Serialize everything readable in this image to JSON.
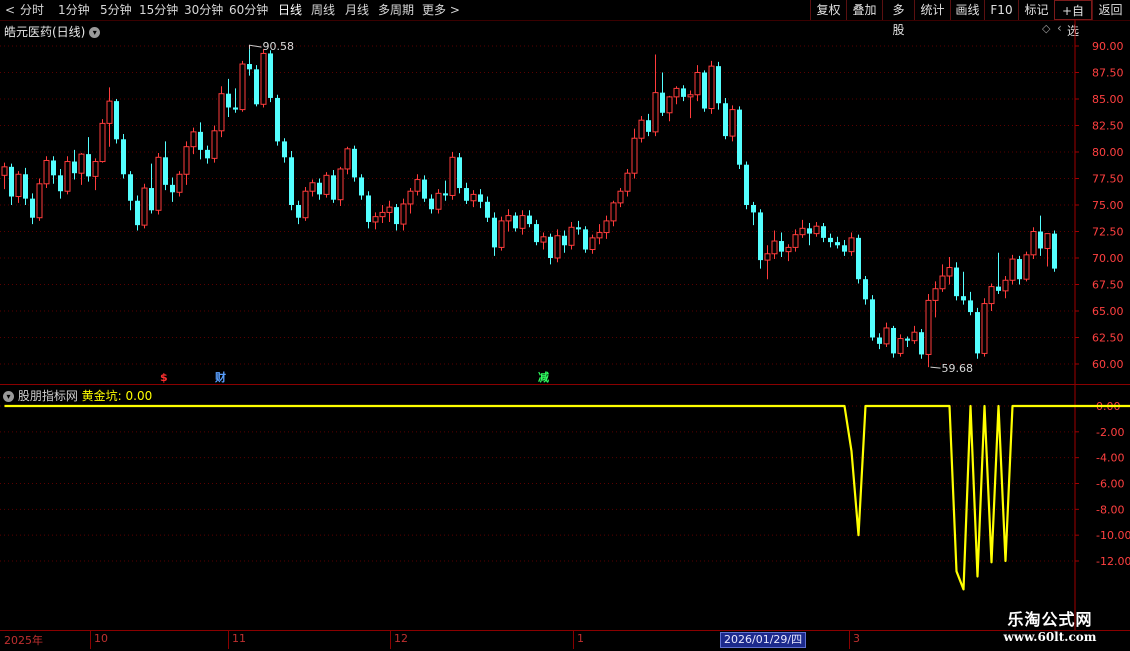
{
  "toolbar": {
    "periods": [
      "分时",
      "1分钟",
      "5分钟",
      "15分钟",
      "30分钟",
      "60分钟",
      "日线",
      "周线",
      "月线",
      "多周期",
      "更多"
    ],
    "active_period": "日线",
    "right_buttons": [
      "复权",
      "叠加",
      "多股",
      "统计",
      "画线",
      "F10",
      "标记",
      "+自选",
      "返回"
    ]
  },
  "colors": {
    "up": "#ff3c3c",
    "down": "#54ffff",
    "grid": "#5a0000",
    "axis_text": "#ff4040",
    "indicator": "#ffff00"
  },
  "main_chart": {
    "title": "皓元医药(日线)",
    "y_ticks": [
      "90.00",
      "87.50",
      "85.00",
      "82.50",
      "80.00",
      "77.50",
      "75.00",
      "72.50",
      "70.00",
      "67.50",
      "65.00",
      "62.50",
      "60.00"
    ],
    "high_label": "90.58",
    "low_label": "59.68",
    "event_markers": [
      {
        "text": "$",
        "color": "#ff3030"
      },
      {
        "text": "财",
        "color": "#5aa0ff"
      },
      {
        "text": "减",
        "color": "#30ff60"
      }
    ]
  },
  "indicator": {
    "name": "股朋指标网",
    "series_label": "黄金坑:",
    "series_value": "0.00",
    "y_ticks": [
      "0.00",
      "-2.00",
      "-4.00",
      "-6.00",
      "-8.00",
      "-10.00",
      "-12.00"
    ]
  },
  "time_axis": {
    "labels": [
      "2025年",
      "10",
      "11",
      "12",
      "1",
      "3"
    ],
    "cursor_date": "2026/01/29/四"
  },
  "watermark": {
    "line1": "乐淘公式网",
    "line2": "www.60lt.com"
  },
  "chart_data": [
    {
      "type": "candlestick",
      "title": "皓元医药(日线)",
      "ylim": [
        59,
        91
      ],
      "candles": [
        [
          77.8,
          79.0,
          76.5,
          78.6
        ],
        [
          78.6,
          78.9,
          75.0,
          75.8
        ],
        [
          75.8,
          78.2,
          75.2,
          77.9
        ],
        [
          77.9,
          78.5,
          75.0,
          75.6
        ],
        [
          75.6,
          76.1,
          73.2,
          73.8
        ],
        [
          73.8,
          77.5,
          73.5,
          77.0
        ],
        [
          77.0,
          79.6,
          76.6,
          79.2
        ],
        [
          79.2,
          79.6,
          77.0,
          77.8
        ],
        [
          77.8,
          78.4,
          75.6,
          76.3
        ],
        [
          76.3,
          79.6,
          76.0,
          79.1
        ],
        [
          79.1,
          80.2,
          77.4,
          78.0
        ],
        [
          78.0,
          79.9,
          76.9,
          79.8
        ],
        [
          79.8,
          81.4,
          77.2,
          77.7
        ],
        [
          77.7,
          79.4,
          76.4,
          79.1
        ],
        [
          79.1,
          83.1,
          79.0,
          82.7
        ],
        [
          82.7,
          86.1,
          80.5,
          84.8
        ],
        [
          84.8,
          85.0,
          80.8,
          81.2
        ],
        [
          81.2,
          81.7,
          77.5,
          77.9
        ],
        [
          77.9,
          78.2,
          74.5,
          75.4
        ],
        [
          75.4,
          75.9,
          72.6,
          73.1
        ],
        [
          73.1,
          77.0,
          72.8,
          76.6
        ],
        [
          76.6,
          78.9,
          74.2,
          74.5
        ],
        [
          74.5,
          79.9,
          74.1,
          79.5
        ],
        [
          79.5,
          81.0,
          76.4,
          76.9
        ],
        [
          76.9,
          77.6,
          75.3,
          76.2
        ],
        [
          76.2,
          78.2,
          75.8,
          77.9
        ],
        [
          77.9,
          81.0,
          76.9,
          80.5
        ],
        [
          80.5,
          82.3,
          79.8,
          81.9
        ],
        [
          81.9,
          82.8,
          79.3,
          80.2
        ],
        [
          80.2,
          80.6,
          78.9,
          79.4
        ],
        [
          79.4,
          82.5,
          79.0,
          82.0
        ],
        [
          82.0,
          86.2,
          81.4,
          85.5
        ],
        [
          85.5,
          86.9,
          83.3,
          84.2
        ],
        [
          84.2,
          86.0,
          83.7,
          84.0
        ],
        [
          84.0,
          88.6,
          83.8,
          88.3
        ],
        [
          88.3,
          89.7,
          87.2,
          87.8
        ],
        [
          87.8,
          88.2,
          84.3,
          84.5
        ],
        [
          84.5,
          89.7,
          84.2,
          89.3
        ],
        [
          89.3,
          89.6,
          84.7,
          85.1
        ],
        [
          85.1,
          85.4,
          80.6,
          81.0
        ],
        [
          81.0,
          81.3,
          79.0,
          79.5
        ],
        [
          79.5,
          80.1,
          74.5,
          75.0
        ],
        [
          75.0,
          75.4,
          73.2,
          73.8
        ],
        [
          73.8,
          76.7,
          73.5,
          76.3
        ],
        [
          76.3,
          77.4,
          75.8,
          77.1
        ],
        [
          77.1,
          77.5,
          75.5,
          76.0
        ],
        [
          76.0,
          78.1,
          75.7,
          77.8
        ],
        [
          77.8,
          78.3,
          75.2,
          75.5
        ],
        [
          75.5,
          78.6,
          74.9,
          78.4
        ],
        [
          78.4,
          80.5,
          77.9,
          80.3
        ],
        [
          80.3,
          80.6,
          77.2,
          77.6
        ],
        [
          77.6,
          77.9,
          75.5,
          75.9
        ],
        [
          75.9,
          76.3,
          72.8,
          73.4
        ],
        [
          73.4,
          74.3,
          72.7,
          73.9
        ],
        [
          73.9,
          75.0,
          73.3,
          74.3
        ],
        [
          74.3,
          75.4,
          73.4,
          74.8
        ],
        [
          74.8,
          75.1,
          72.6,
          73.2
        ],
        [
          73.2,
          75.6,
          72.6,
          75.1
        ],
        [
          75.1,
          76.6,
          74.2,
          76.3
        ],
        [
          76.3,
          77.9,
          75.9,
          77.4
        ],
        [
          77.4,
          77.8,
          75.3,
          75.6
        ],
        [
          75.6,
          76.0,
          74.2,
          74.6
        ],
        [
          74.6,
          76.5,
          74.2,
          76.1
        ],
        [
          76.1,
          77.3,
          75.4,
          75.9
        ],
        [
          75.9,
          80.0,
          75.5,
          79.5
        ],
        [
          79.5,
          79.9,
          76.1,
          76.6
        ],
        [
          76.6,
          77.1,
          75.1,
          75.4
        ],
        [
          75.4,
          76.4,
          74.8,
          76.0
        ],
        [
          76.0,
          76.5,
          74.7,
          75.3
        ],
        [
          75.3,
          75.8,
          73.4,
          73.8
        ],
        [
          73.8,
          74.3,
          70.2,
          71.0
        ],
        [
          71.0,
          73.9,
          70.7,
          73.5
        ],
        [
          73.5,
          74.6,
          72.5,
          74.0
        ],
        [
          74.0,
          74.3,
          72.5,
          72.8
        ],
        [
          72.8,
          74.5,
          72.2,
          74.0
        ],
        [
          74.0,
          74.5,
          72.9,
          73.2
        ],
        [
          73.2,
          73.6,
          71.2,
          71.5
        ],
        [
          71.5,
          72.4,
          70.8,
          72.0
        ],
        [
          72.0,
          72.3,
          69.4,
          70.0
        ],
        [
          70.0,
          72.7,
          69.6,
          72.1
        ],
        [
          72.1,
          72.6,
          70.5,
          71.2
        ],
        [
          71.2,
          73.4,
          70.8,
          72.9
        ],
        [
          72.9,
          73.5,
          72.2,
          72.7
        ],
        [
          72.7,
          73.0,
          70.5,
          70.8
        ],
        [
          70.8,
          72.2,
          70.4,
          71.9
        ],
        [
          71.9,
          73.2,
          71.3,
          72.4
        ],
        [
          72.4,
          74.0,
          71.8,
          73.5
        ],
        [
          73.5,
          75.4,
          73.0,
          75.2
        ],
        [
          75.2,
          76.6,
          74.8,
          76.3
        ],
        [
          76.3,
          78.4,
          75.8,
          78.0
        ],
        [
          78.0,
          82.2,
          77.5,
          81.3
        ],
        [
          81.3,
          83.4,
          80.9,
          83.0
        ],
        [
          83.0,
          83.6,
          81.5,
          81.9
        ],
        [
          81.9,
          89.2,
          81.5,
          85.6
        ],
        [
          85.6,
          87.5,
          83.4,
          83.7
        ],
        [
          83.7,
          85.3,
          82.9,
          85.2
        ],
        [
          85.2,
          86.2,
          84.5,
          86.0
        ],
        [
          86.0,
          86.3,
          84.8,
          85.2
        ],
        [
          85.2,
          85.8,
          83.2,
          85.4
        ],
        [
          85.4,
          88.2,
          84.8,
          87.5
        ],
        [
          87.5,
          87.7,
          83.8,
          84.1
        ],
        [
          84.1,
          88.6,
          83.6,
          88.1
        ],
        [
          88.1,
          88.5,
          84.0,
          84.6
        ],
        [
          84.6,
          85.1,
          81.2,
          81.5
        ],
        [
          81.5,
          84.4,
          81.0,
          84.0
        ],
        [
          84.0,
          84.3,
          78.4,
          78.8
        ],
        [
          78.8,
          79.1,
          74.6,
          75.0
        ],
        [
          75.0,
          75.3,
          73.1,
          74.3
        ],
        [
          74.3,
          74.6,
          69.0,
          69.8
        ],
        [
          69.8,
          71.2,
          68.0,
          70.4
        ],
        [
          70.4,
          72.6,
          69.9,
          71.6
        ],
        [
          71.6,
          72.4,
          70.1,
          70.6
        ],
        [
          70.6,
          71.3,
          69.7,
          71.0
        ],
        [
          71.0,
          72.7,
          70.6,
          72.2
        ],
        [
          72.2,
          73.6,
          71.9,
          72.8
        ],
        [
          72.8,
          73.3,
          71.2,
          72.3
        ],
        [
          72.3,
          73.4,
          72.0,
          73.0
        ],
        [
          73.0,
          73.3,
          71.5,
          71.9
        ],
        [
          71.9,
          72.3,
          71.0,
          71.5
        ],
        [
          71.5,
          72.0,
          70.9,
          71.2
        ],
        [
          71.2,
          71.7,
          70.2,
          70.6
        ],
        [
          70.6,
          72.4,
          70.2,
          71.9
        ],
        [
          71.9,
          72.2,
          67.6,
          68.0
        ],
        [
          68.0,
          68.3,
          65.6,
          66.1
        ],
        [
          66.1,
          66.5,
          62.2,
          62.5
        ],
        [
          62.5,
          62.9,
          61.4,
          61.9
        ],
        [
          61.9,
          63.9,
          61.6,
          63.4
        ],
        [
          63.4,
          63.6,
          60.6,
          61.0
        ],
        [
          61.0,
          62.8,
          60.7,
          62.4
        ],
        [
          62.4,
          62.6,
          61.6,
          62.2
        ],
        [
          62.2,
          63.6,
          61.9,
          63.0
        ],
        [
          63.0,
          63.3,
          60.5,
          60.9
        ],
        [
          60.9,
          66.6,
          59.7,
          66.0
        ],
        [
          66.0,
          67.8,
          64.4,
          67.1
        ],
        [
          67.1,
          69.4,
          66.8,
          68.3
        ],
        [
          68.3,
          70.1,
          67.5,
          69.1
        ],
        [
          69.1,
          69.6,
          66.0,
          66.4
        ],
        [
          66.4,
          68.7,
          65.6,
          66.0
        ],
        [
          66.0,
          66.8,
          64.6,
          64.9
        ],
        [
          64.9,
          65.3,
          60.5,
          61.0
        ],
        [
          61.0,
          66.2,
          60.7,
          65.7
        ],
        [
          65.7,
          67.6,
          65.0,
          67.3
        ],
        [
          67.3,
          70.5,
          66.6,
          66.9
        ],
        [
          66.9,
          68.3,
          66.2,
          67.9
        ],
        [
          67.9,
          70.3,
          67.5,
          69.9
        ],
        [
          69.9,
          70.2,
          67.5,
          68.0
        ],
        [
          68.0,
          70.6,
          67.8,
          70.3
        ],
        [
          70.3,
          72.9,
          69.9,
          72.5
        ],
        [
          72.5,
          74.0,
          70.2,
          70.9
        ],
        [
          70.9,
          72.0,
          69.2,
          72.3
        ],
        [
          72.3,
          72.6,
          68.7,
          69.0
        ]
      ]
    },
    {
      "type": "line",
      "series": [
        {
          "name": "黄金坑",
          "values": [
            0,
            0,
            0,
            0,
            0,
            0,
            0,
            0,
            0,
            0,
            0,
            0,
            0,
            0,
            0,
            0,
            0,
            0,
            0,
            0,
            0,
            0,
            0,
            0,
            0,
            0,
            0,
            0,
            0,
            0,
            0,
            0,
            0,
            0,
            0,
            0,
            0,
            0,
            0,
            0,
            0,
            0,
            0,
            0,
            0,
            0,
            0,
            0,
            0,
            0,
            0,
            0,
            0,
            0,
            0,
            0,
            0,
            0,
            0,
            0,
            0,
            0,
            0,
            0,
            0,
            0,
            0,
            0,
            0,
            0,
            0,
            0,
            0,
            0,
            0,
            0,
            0,
            0,
            0,
            0,
            0,
            0,
            0,
            0,
            0,
            0,
            0,
            0,
            0,
            0,
            0,
            0,
            0,
            0,
            0,
            0,
            0,
            0,
            0,
            0,
            0,
            0,
            0,
            0,
            0,
            0,
            0,
            0,
            0,
            0,
            0,
            0,
            0,
            0,
            0,
            0,
            0,
            0,
            0,
            0,
            0,
            -3.5,
            -10.0,
            0,
            0,
            0,
            0,
            0,
            0,
            0,
            0,
            0,
            0,
            0,
            0,
            0,
            -12.8,
            -14.2,
            0,
            -13.2,
            0,
            -12.1,
            0,
            -12.0,
            0,
            0,
            0,
            0,
            0,
            0,
            0,
            0,
            0,
            0,
            0,
            0,
            0,
            0,
            0,
            0,
            0,
            0,
            0,
            0,
            0,
            0,
            0,
            0,
            0,
            0,
            0
          ]
        }
      ],
      "ylim": [
        -14.4,
        0.9
      ]
    }
  ]
}
